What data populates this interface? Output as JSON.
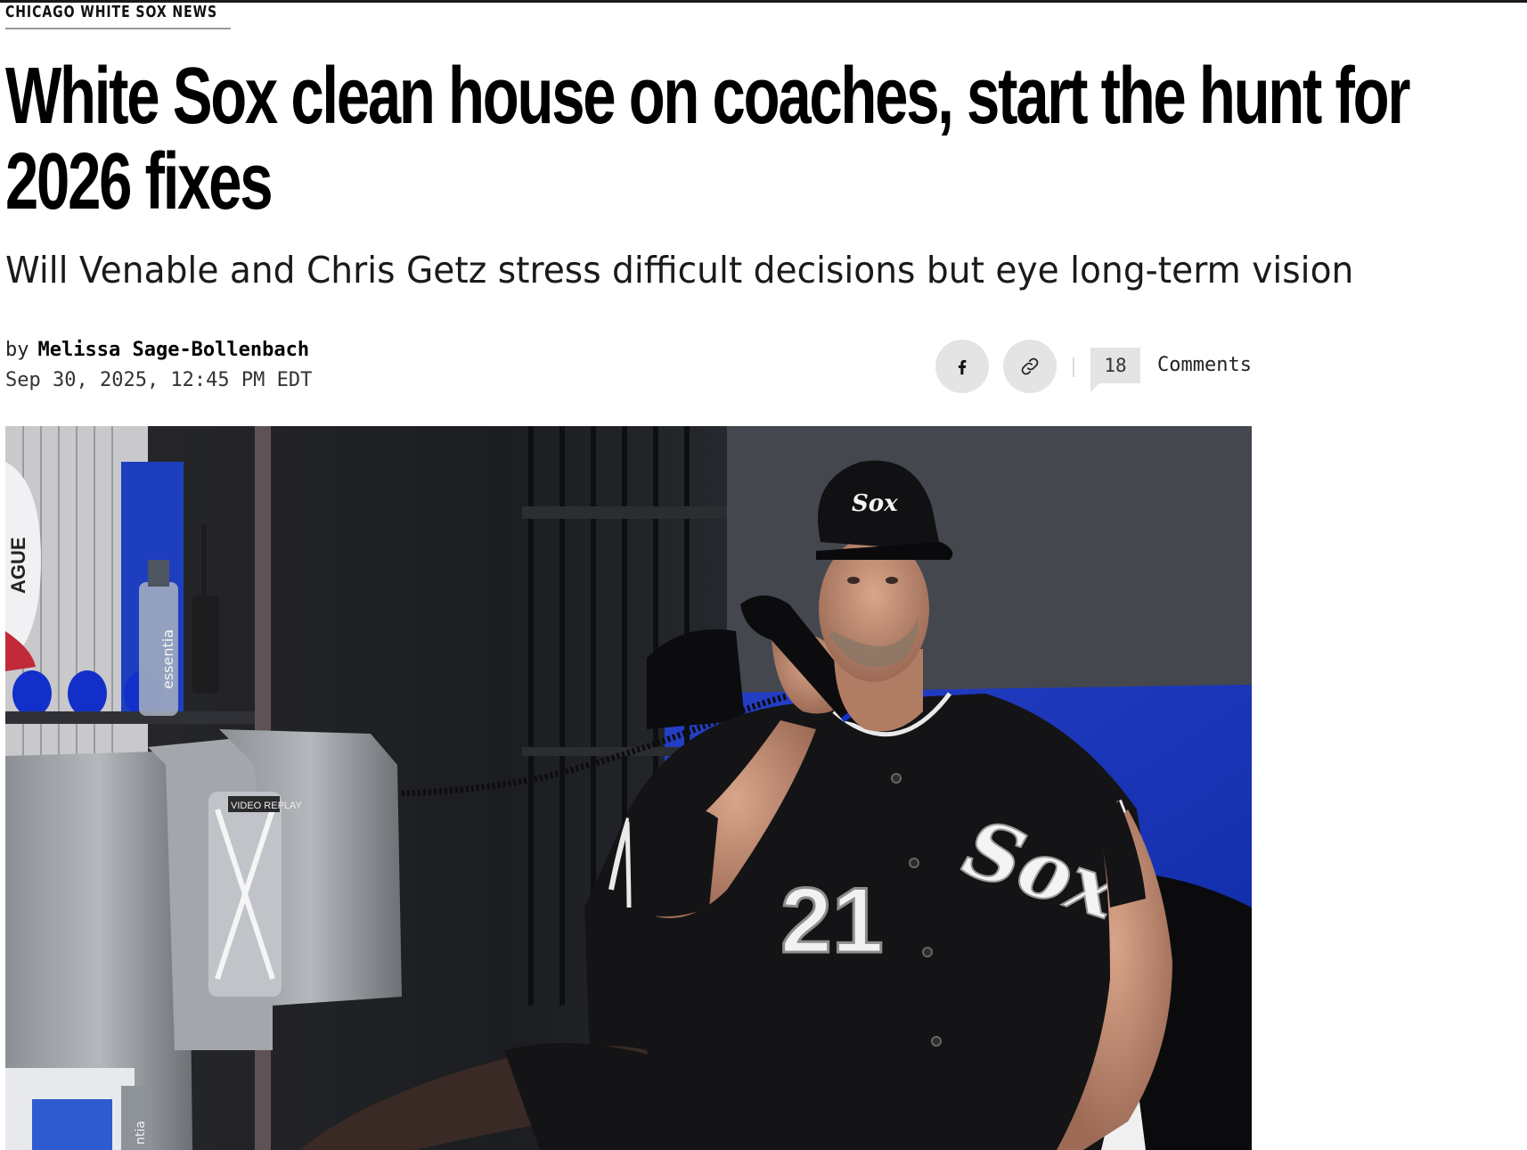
{
  "section": {
    "label": "CHICAGO WHITE SOX NEWS"
  },
  "article": {
    "headline": "White Sox clean house on coaches, start the hunt for 2026 fixes",
    "dek": "Will Venable and Chris Getz stress difficult decisions but eye long-term vision",
    "byline_prefix": "by",
    "author": "Melissa Sage-Bollenbach",
    "date": "Sep 30, 2025, 12:45 PM EDT"
  },
  "share": {
    "facebook_icon": "facebook-icon",
    "link_icon": "link-icon"
  },
  "comments": {
    "count": "18",
    "label": "Comments"
  },
  "photo": {
    "bottle_label": "essentia",
    "replay_label": "VIDEO REPLAY",
    "jersey_number": "21",
    "cap_logo": "Sox",
    "jersey_logo": "Sox",
    "wall_text": "AGUE",
    "bottom_label": "ntia"
  },
  "colors": {
    "top_bar": "#1a1a1a",
    "share_button_bg": "#e4e4e4",
    "comment_bubble_bg": "#e4e4e4",
    "headline_text": "#000000",
    "dugout_blue": "#1d3fbf"
  }
}
